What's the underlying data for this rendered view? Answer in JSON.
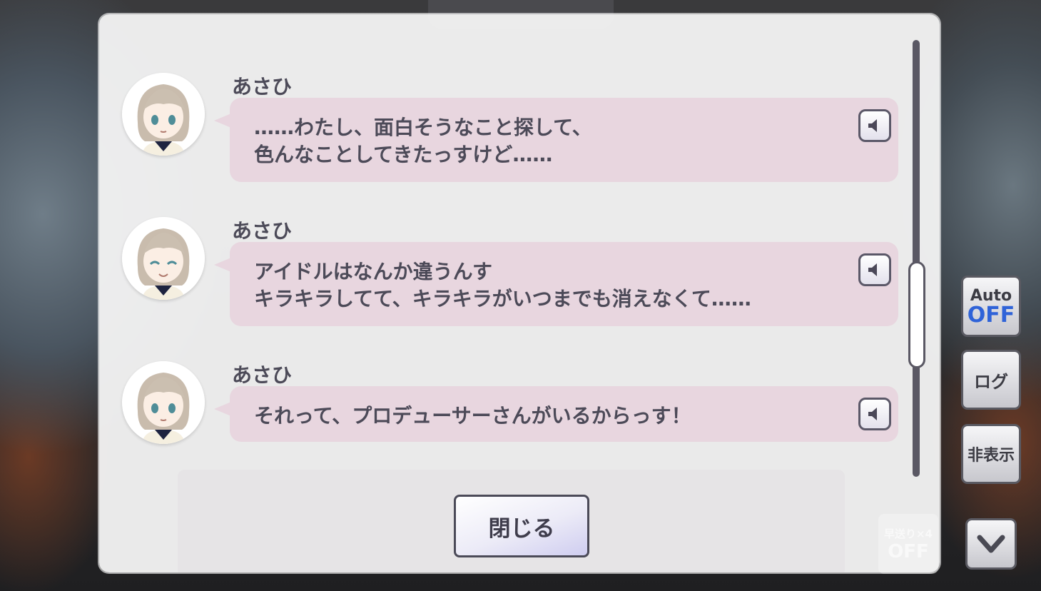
{
  "log": {
    "entries": [
      {
        "speaker": "あさひ",
        "line1": "……わたし、面白そうなこと探して、",
        "line2": "色んなことしてきたっすけど……"
      },
      {
        "speaker": "あさひ",
        "line1": "アイドルはなんか違うんす",
        "line2": "キラキラしてて、キラキラがいつまでも消えなくて……"
      },
      {
        "speaker": "あさひ",
        "line1": "それって、プロデューサーさんがいるからっす！",
        "line2": ""
      }
    ],
    "close_label": "閉じる"
  },
  "side": {
    "auto_label": "Auto",
    "auto_state": "OFF",
    "log_label": "ログ",
    "hide_label": "非表示",
    "ff_label": "早送り×4",
    "ff_state": "OFF"
  },
  "icons": {
    "voice": "speaker-icon",
    "skip": "chevron-down-icon"
  },
  "colors": {
    "bubble": "#e8d6df",
    "text": "#4c4a58",
    "auto_off": "#2f63d8"
  }
}
